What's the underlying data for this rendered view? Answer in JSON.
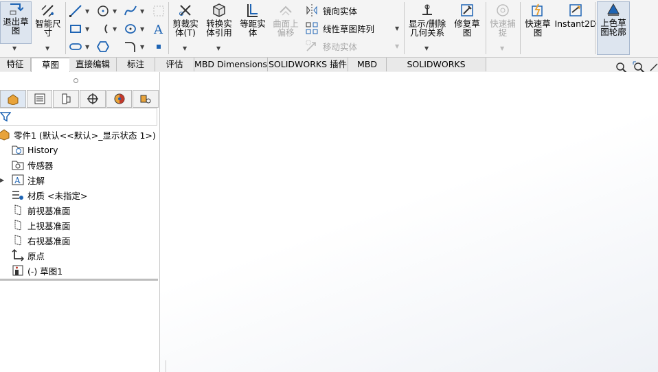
{
  "ribbon": {
    "exit_sketch": "退出草\n图",
    "smart_dimension": "智能尺\n寸",
    "trim": "剪裁实\n体(T)",
    "convert": "转换实\n体引用",
    "offset": "等距实\n体",
    "surface_offset": "曲面上\n偏移",
    "mirror": "镜向实体",
    "linear_pattern": "线性草图阵列",
    "move": "移动实体",
    "display_relations": "显示/删除\n几何关系",
    "repair": "修复草\n图",
    "quick_snap": "快速捕\n捉",
    "rapid_sketch": "快速草\n图",
    "instant2d": "Instant2D",
    "shaded_sketch": "上色草\n图轮廓"
  },
  "tabs": [
    "特征",
    "草图",
    "直接编辑",
    "标注",
    "评估",
    "MBD Dimensions",
    "SOLIDWORKS 插件",
    "MBD",
    "SOLIDWORKS Inspection"
  ],
  "active_tab": "草图",
  "tree": {
    "root": "零件1 (默认<<默认>_显示状态 1>)",
    "items": [
      "History",
      "传感器",
      "注解",
      "材质 <未指定>",
      "前视基准面",
      "上视基准面",
      "右视基准面",
      "原点",
      "(-) 草图1"
    ]
  },
  "colors": {
    "accent": "#1e64b4",
    "orange": "#e8a33a"
  }
}
